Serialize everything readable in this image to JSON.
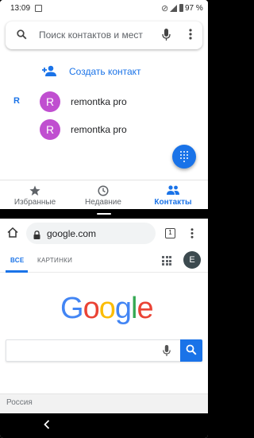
{
  "status": {
    "time": "13:09",
    "battery": "97 %"
  },
  "contacts": {
    "search_placeholder": "Поиск контактов и мест",
    "create_label": "Создать контакт",
    "section_letter": "R",
    "items": [
      {
        "initial": "R",
        "name": "remontka pro"
      },
      {
        "initial": "R",
        "name": "remontka pro"
      }
    ],
    "nav": [
      {
        "label": "Избранные",
        "icon": "star-icon",
        "active": false
      },
      {
        "label": "Недавние",
        "icon": "clock-icon",
        "active": false
      },
      {
        "label": "Контакты",
        "icon": "people-icon",
        "active": true
      }
    ],
    "accent": "#1a73e8",
    "avatar_color": "#c04fd0"
  },
  "browser": {
    "url": "google.com",
    "tab_count": "1",
    "tabs": [
      {
        "label": "ВСЕ",
        "active": true
      },
      {
        "label": "КАРТИНКИ",
        "active": false
      }
    ],
    "account_initial": "E",
    "logo": "Google",
    "footer_region": "Россия"
  }
}
